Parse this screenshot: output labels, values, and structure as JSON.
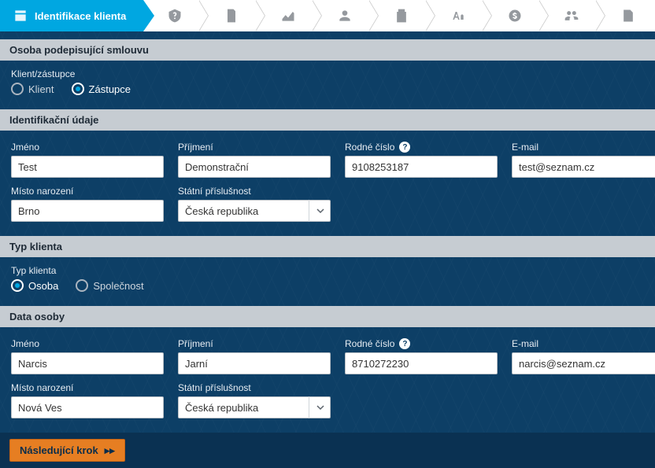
{
  "wizard": {
    "active_label": "Identifikace klienta"
  },
  "section_signing": {
    "title": "Osoba podepisující smlouvu",
    "group_label": "Klient/zástupce",
    "options": {
      "klient": "Klient",
      "zastupce": "Zástupce"
    },
    "selected": "zastupce"
  },
  "section_identity": {
    "title": "Identifikační údaje",
    "fields": {
      "jmeno": {
        "label": "Jméno",
        "value": "Test"
      },
      "prijmeni": {
        "label": "Příjmení",
        "value": "Demonstrační"
      },
      "rodne": {
        "label": "Rodné číslo",
        "value": "9108253187"
      },
      "email": {
        "label": "E-mail",
        "value": "test@seznam.cz"
      },
      "misto": {
        "label": "Místo narození",
        "value": "Brno"
      },
      "stat": {
        "label": "Státní příslušnost",
        "value": "Česká republika"
      }
    }
  },
  "section_client_type": {
    "title": "Typ klienta",
    "group_label": "Typ klienta",
    "options": {
      "osoba": "Osoba",
      "spolecnost": "Společnost"
    },
    "selected": "osoba"
  },
  "section_person_data": {
    "title": "Data osoby",
    "fields": {
      "jmeno": {
        "label": "Jméno",
        "value": "Narcis"
      },
      "prijmeni": {
        "label": "Příjmení",
        "value": "Jarní"
      },
      "rodne": {
        "label": "Rodné číslo",
        "value": "8710272230"
      },
      "email": {
        "label": "E-mail",
        "value": "narcis@seznam.cz"
      },
      "misto": {
        "label": "Místo narození",
        "value": "Nová Ves"
      },
      "stat": {
        "label": "Státní příslušnost",
        "value": "Česká republika"
      }
    }
  },
  "footer": {
    "next_label": "Následující krok"
  }
}
